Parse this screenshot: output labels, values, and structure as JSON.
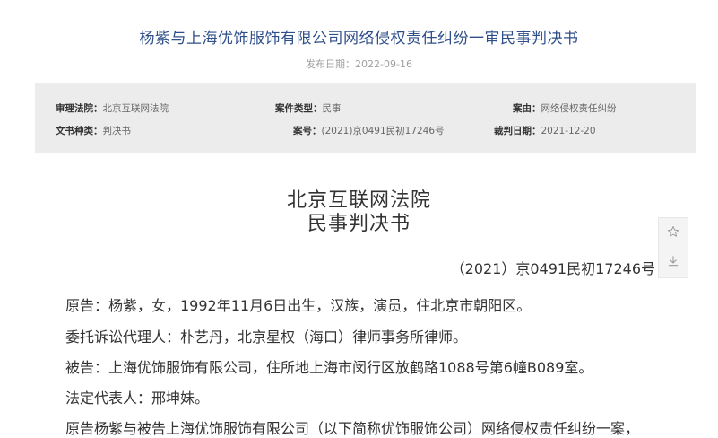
{
  "header": {
    "title": "杨紫与上海优饰服饰有限公司网络侵权责任纠纷一审民事判决书",
    "publish_label": "发布日期：",
    "publish_date": "2022-09-16"
  },
  "info": {
    "court_label": "审理法院：",
    "court_value": "北京互联网法院",
    "case_type_label": "案件类型：",
    "case_type_value": "民事",
    "cause_label": "案由：",
    "cause_value": "网络侵权责任纠纷",
    "doc_type_label": "文书种类：",
    "doc_type_value": "判决书",
    "case_no_label": "案号：",
    "case_no_value": "(2021)京0491民初17246号",
    "judge_date_label": "裁判日期：",
    "judge_date_value": "2021-12-20"
  },
  "document": {
    "court_name": "北京互联网法院",
    "doc_kind": "民事判决书",
    "case_number": "（2021）京0491民初17246号",
    "paragraphs": [
      "原告：杨紫，女，1992年11月6日出生，汉族，演员，住北京市朝阳区。",
      "委托诉讼代理人：朴艺丹，北京星权（海口）律师事务所律师。",
      "被告：上海优饰服饰有限公司，住所地上海市闵行区放鹤路1088号第6幢B089室。",
      "法定代表人：邢坤妹。",
      "原告杨紫与被告上海优饰服饰有限公司（以下简称优饰服饰公司）网络侵权责任纠纷一案，"
    ]
  },
  "tools": {
    "favorite_icon": "star-icon",
    "download_icon": "download-icon"
  }
}
